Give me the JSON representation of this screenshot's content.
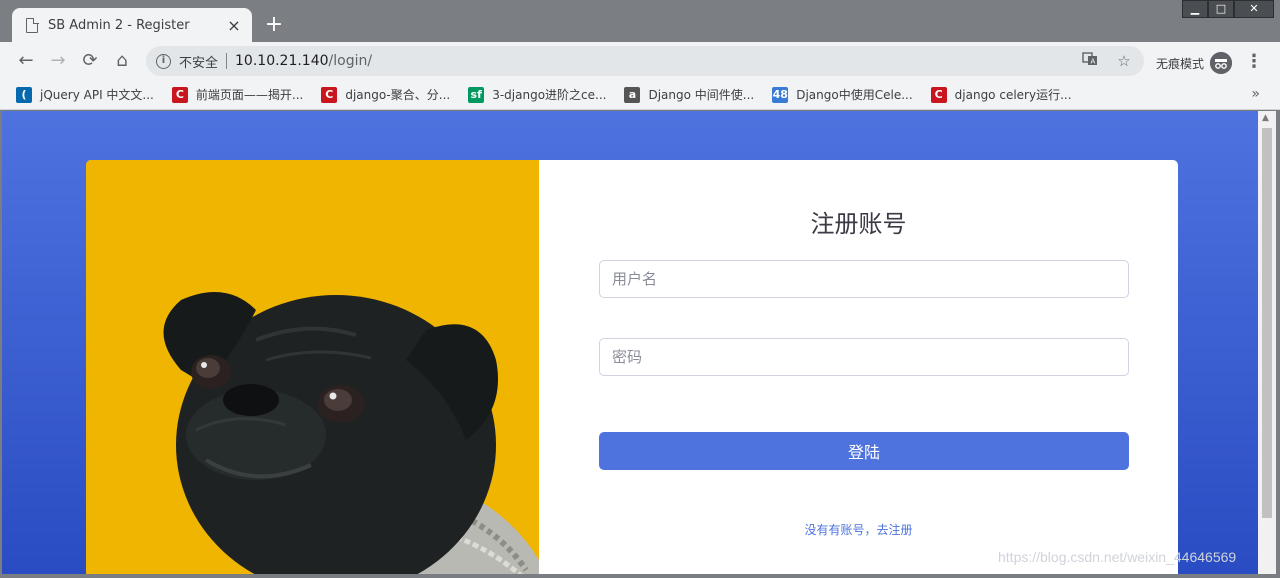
{
  "tab": {
    "title": "SB Admin 2 - Register",
    "close": "×",
    "new_tab": "+"
  },
  "window": {
    "minimize": "▁",
    "maximize": "□",
    "close": "✕"
  },
  "toolbar": {
    "back": "←",
    "forward": "→",
    "reload": "⟳",
    "home": "⌂",
    "security_label": "不安全",
    "url_host": "10.10.21.140",
    "url_path": "/login/",
    "translate_icon": "translate-icon",
    "star_icon": "star-icon",
    "incognito_label": "无痕模式",
    "menu": "⋮"
  },
  "bookmarks": [
    {
      "label": "jQuery API 中文文...",
      "icon_color": "#0769ad",
      "glyph": "("
    },
    {
      "label": "前端页面——揭开...",
      "icon_color": "#c9151e",
      "glyph": "C"
    },
    {
      "label": "django-聚合、分...",
      "icon_color": "#c9151e",
      "glyph": "C"
    },
    {
      "label": "3-django进阶之ce...",
      "icon_color": "#009a61",
      "glyph": "sf"
    },
    {
      "label": "Django 中间件使...",
      "icon_color": "#555555",
      "glyph": "a"
    },
    {
      "label": "Django中使用Cele...",
      "icon_color": "#3a7bd5",
      "glyph": "48"
    },
    {
      "label": "django celery运行...",
      "icon_color": "#c9151e",
      "glyph": "C"
    }
  ],
  "bookmarks_more": "»",
  "page": {
    "title": "注册账号",
    "username_placeholder": "用户名",
    "password_placeholder": "密码",
    "login_button": "登陆",
    "register_link": "没有有账号，去注册"
  },
  "watermark": "https://blog.csdn.net/weixin_44646569",
  "colors": {
    "primary": "#4e73df",
    "photo_bg": "#f0b500"
  }
}
